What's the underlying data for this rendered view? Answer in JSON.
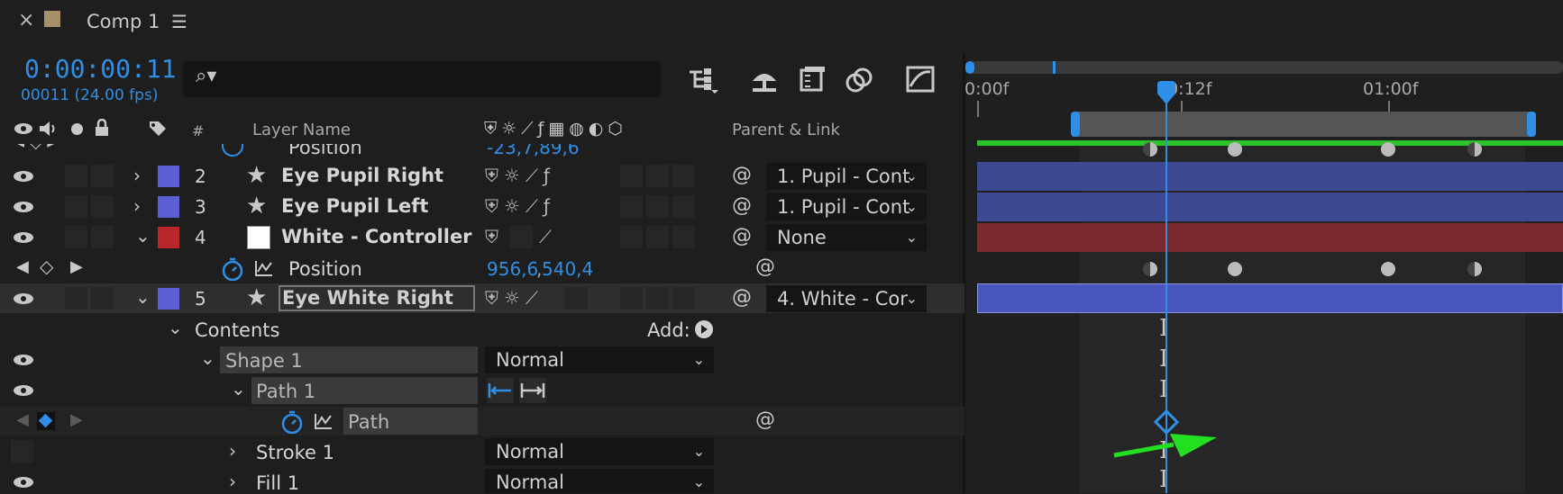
{
  "panel": {
    "close_glyph": "×",
    "comp_name": "Comp 1",
    "menu_glyph": "☰"
  },
  "time": {
    "timecode": "0:00:00:11",
    "frames": "00011 (24.00 fps)"
  },
  "search": {
    "placeholder": "",
    "icon_glyph": "⌕▾"
  },
  "columns": {
    "number": "#",
    "layer_name": "Layer Name",
    "parent_link": "Parent & Link"
  },
  "ruler": {
    "t0": "0:00f",
    "t12": "00:12f",
    "t24": "01:00f"
  },
  "top_position": {
    "label": "Position",
    "value": "-23,7,89,6"
  },
  "layers": [
    {
      "num": "2",
      "name": "Eye Pupil Right",
      "parent": "1. Pupil - Cont",
      "color": "#5b5fd3"
    },
    {
      "num": "3",
      "name": "Eye Pupil Left",
      "parent": "1. Pupil - Cont",
      "color": "#5b5fd3"
    },
    {
      "num": "4",
      "name": "White - Controller",
      "parent": "None",
      "color": "#b8282a"
    },
    {
      "num": "5",
      "name": "Eye White Right",
      "parent": "4. White - Cor",
      "color": "#5b5fd3"
    }
  ],
  "position_prop": {
    "label": "Position",
    "value_x": "956,6",
    "sep": ",",
    "value_y": "540,4"
  },
  "contents": {
    "label": "Contents",
    "add_label": "Add:"
  },
  "shape1": {
    "label": "Shape 1",
    "blend": "Normal"
  },
  "path1": {
    "label": "Path 1"
  },
  "path_prop": {
    "label": "Path"
  },
  "stroke1": {
    "label": "Stroke 1",
    "blend": "Normal"
  },
  "fill1": {
    "label": "Fill 1",
    "blend": "Normal"
  },
  "colors": {
    "accent": "#2f8fe6",
    "work_area_green": "#2bc22b",
    "arrow_green": "#22e020",
    "layer_blue": "#3c4a93",
    "layer_red": "#7a2a2c"
  }
}
